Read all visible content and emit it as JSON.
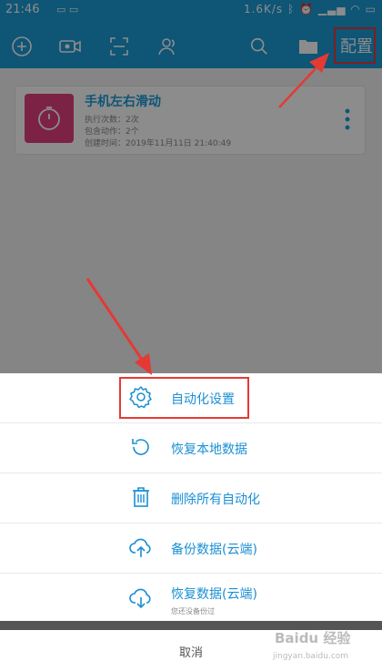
{
  "status_bar": {
    "time": "21:46",
    "network_speed": "1.6K/s",
    "icons": [
      "bluetooth-icon",
      "alarm-icon",
      "signal-icon",
      "wifi-icon",
      "battery-icon"
    ]
  },
  "toolbar": {
    "icons": [
      "add-icon",
      "video-icon",
      "scan-icon",
      "users-icon",
      "search-icon",
      "folder-icon"
    ],
    "config_label": "配置"
  },
  "card": {
    "title": "手机左右滑动",
    "exec_count": "执行次数：2次",
    "actions": "包含动作：2个",
    "created": "创建时间：2019年11月11日 21:40:49"
  },
  "menu": {
    "items": [
      {
        "label": "自动化设置",
        "icon": "gear-icon"
      },
      {
        "label": "恢复本地数据",
        "icon": "restore-icon"
      },
      {
        "label": "删除所有自动化",
        "icon": "trash-icon"
      },
      {
        "label": "备份数据(云端)",
        "icon": "cloud-upload-icon"
      },
      {
        "label": "恢复数据(云端)",
        "sub": "您还没备份过",
        "icon": "cloud-download-icon"
      }
    ],
    "cancel_label": "取消"
  },
  "watermark": {
    "main": "Baidu 经验",
    "sub": "jingyan.baidu.com"
  },
  "colors": {
    "primary": "#1a9bd7",
    "menu_text": "#1a8fd4",
    "annotation": "#e53935",
    "thumb": "#e23e7e"
  }
}
